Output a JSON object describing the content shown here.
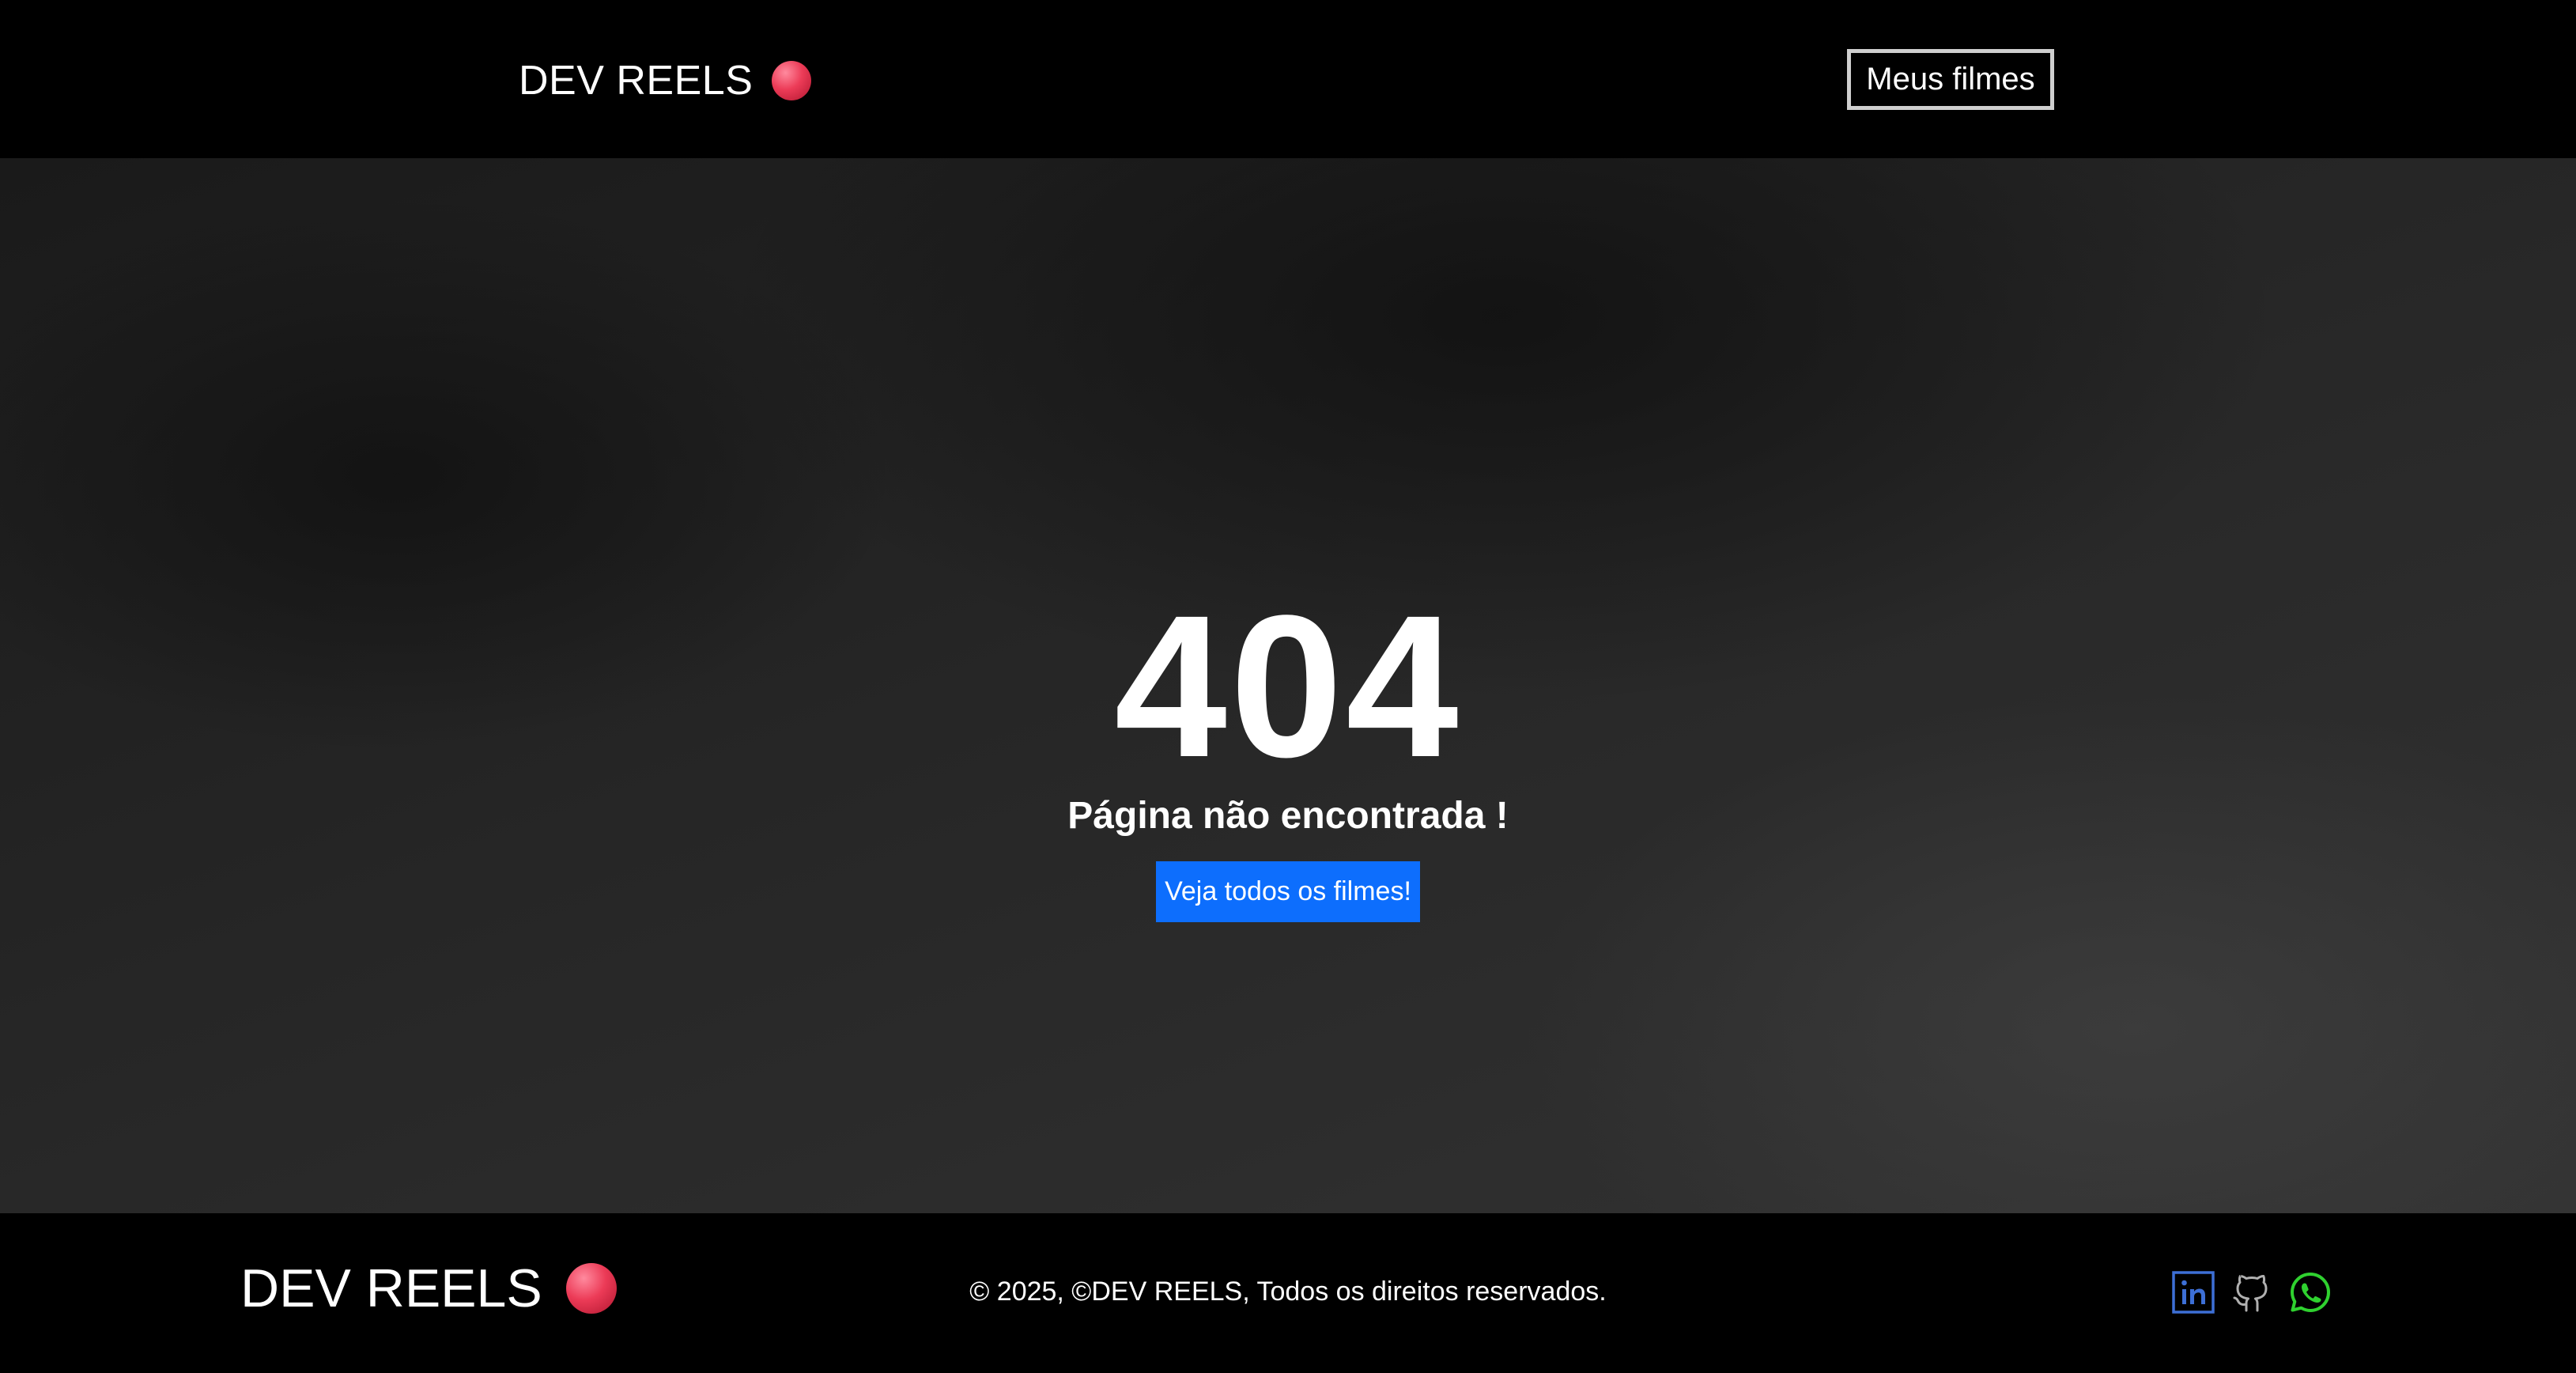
{
  "header": {
    "brand": "DEV REELS",
    "nav_button": "Meus filmes"
  },
  "main": {
    "error_code": "404",
    "error_message": "Página não encontrada !",
    "cta_label": "Veja todos os filmes!"
  },
  "footer": {
    "brand": "DEV REELS",
    "copyright": "© 2025, ©DEV REELS, Todos os direitos reservados.",
    "social_icons": [
      "linkedin-icon",
      "github-icon",
      "whatsapp-icon"
    ]
  },
  "colors": {
    "background": "#000000",
    "brand_dot": "#ec3b57",
    "cta": "#0d6efd",
    "linkedin": "#3d6fd6",
    "github": "#b0b0b0",
    "whatsapp": "#2fd12f"
  }
}
